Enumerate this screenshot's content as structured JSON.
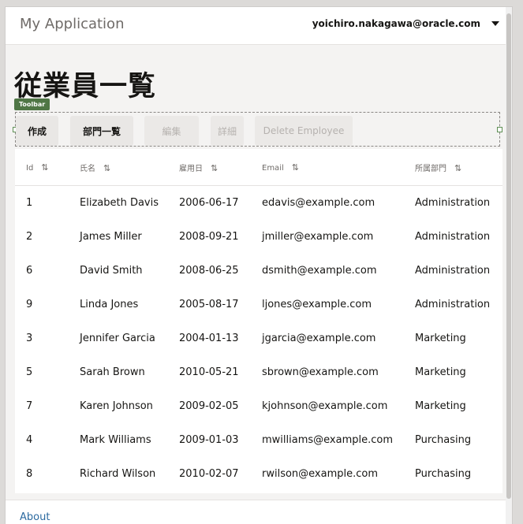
{
  "header": {
    "app_title": "My Application",
    "user_email": "yoichiro.nakagawa@oracle.com"
  },
  "page": {
    "title": "従業員一覧"
  },
  "toolbar": {
    "tag": "Toolbar",
    "buttons": {
      "create": "作成",
      "departments": "部門一覧",
      "edit": "編集",
      "details": "詳細",
      "delete": "Delete Employee"
    }
  },
  "table": {
    "headers": {
      "id": "Id",
      "name": "氏名",
      "hire_date": "雇用日",
      "email": "Email",
      "department": "所属部門"
    },
    "rows": [
      {
        "id": "1",
        "name": "Elizabeth Davis",
        "hire_date": "2006-06-17",
        "email": "edavis@example.com",
        "department": "Administration"
      },
      {
        "id": "2",
        "name": "James Miller",
        "hire_date": "2008-09-21",
        "email": "jmiller@example.com",
        "department": "Administration"
      },
      {
        "id": "6",
        "name": "David Smith",
        "hire_date": "2008-06-25",
        "email": "dsmith@example.com",
        "department": "Administration"
      },
      {
        "id": "9",
        "name": "Linda Jones",
        "hire_date": "2005-08-17",
        "email": "ljones@example.com",
        "department": "Administration"
      },
      {
        "id": "3",
        "name": "Jennifer Garcia",
        "hire_date": "2004-01-13",
        "email": "jgarcia@example.com",
        "department": "Marketing"
      },
      {
        "id": "5",
        "name": "Sarah Brown",
        "hire_date": "2010-05-21",
        "email": "sbrown@example.com",
        "department": "Marketing"
      },
      {
        "id": "7",
        "name": "Karen Johnson",
        "hire_date": "2009-02-05",
        "email": "kjohnson@example.com",
        "department": "Marketing"
      },
      {
        "id": "4",
        "name": "Mark Williams",
        "hire_date": "2009-01-03",
        "email": "mwilliams@example.com",
        "department": "Purchasing"
      },
      {
        "id": "8",
        "name": "Richard Wilson",
        "hire_date": "2010-02-07",
        "email": "rwilson@example.com",
        "department": "Purchasing"
      }
    ]
  },
  "footer": {
    "about": "About"
  },
  "icons": {
    "sort": "sort-arrows-icon",
    "user_menu": "chevron-down-icon"
  },
  "colors": {
    "toolbar_tag": "#4f7645",
    "link": "#2c6aa0"
  }
}
